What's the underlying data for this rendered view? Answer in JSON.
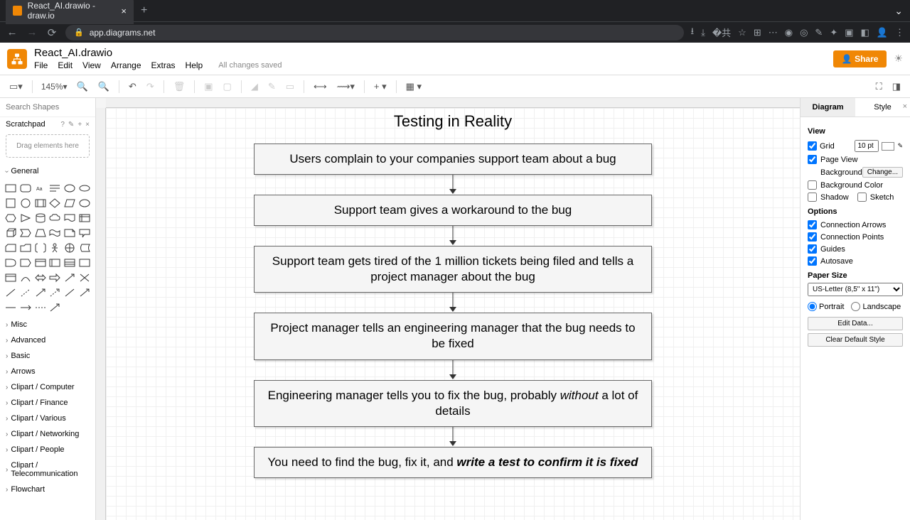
{
  "browser": {
    "tab_title": "React_AI.drawio - draw.io",
    "url": "app.diagrams.net",
    "nav": {
      "back": "←",
      "forward": "→",
      "reload": "⟳"
    }
  },
  "header": {
    "doc_title": "React_AI.drawio",
    "menus": [
      "File",
      "Edit",
      "View",
      "Arrange",
      "Extras",
      "Help"
    ],
    "save_status": "All changes saved",
    "share_label": "Share"
  },
  "toolbar": {
    "zoom": "145%"
  },
  "sidebar_left": {
    "search_placeholder": "Search Shapes",
    "scratchpad_label": "Scratchpad",
    "drag_hint": "Drag elements here",
    "general_label": "General",
    "categories": [
      "Misc",
      "Advanced",
      "Basic",
      "Arrows",
      "Clipart / Computer",
      "Clipart / Finance",
      "Clipart / Various",
      "Clipart / Networking",
      "Clipart / People",
      "Clipart / Telecommunication",
      "Flowchart"
    ]
  },
  "diagram": {
    "title": "Testing in Reality",
    "boxes": [
      "Users complain to your companies support team about a bug",
      "Support team gives a workaround to the bug",
      "Support team gets tired of the 1 million tickets being filed and tells a project manager about the bug",
      "Project manager tells an engineering manager that the bug needs to be fixed",
      "Engineering manager tells you to fix the bug, probably <i>without</i> a lot of details",
      "You need to find the bug, fix it, and <b><i>write a test to confirm it is fixed</i></b>"
    ]
  },
  "sidebar_right": {
    "tabs": [
      "Diagram",
      "Style"
    ],
    "view_label": "View",
    "grid_label": "Grid",
    "grid_value": "10 pt",
    "pageview_label": "Page View",
    "background_label": "Background",
    "change_label": "Change...",
    "bgcolor_label": "Background Color",
    "shadow_label": "Shadow",
    "sketch_label": "Sketch",
    "options_label": "Options",
    "conn_arrows_label": "Connection Arrows",
    "conn_points_label": "Connection Points",
    "guides_label": "Guides",
    "autosave_label": "Autosave",
    "papersize_label": "Paper Size",
    "papersize_value": "US-Letter (8,5\" x 11\")",
    "portrait_label": "Portrait",
    "landscape_label": "Landscape",
    "editdata_label": "Edit Data...",
    "cleardefault_label": "Clear Default Style"
  }
}
